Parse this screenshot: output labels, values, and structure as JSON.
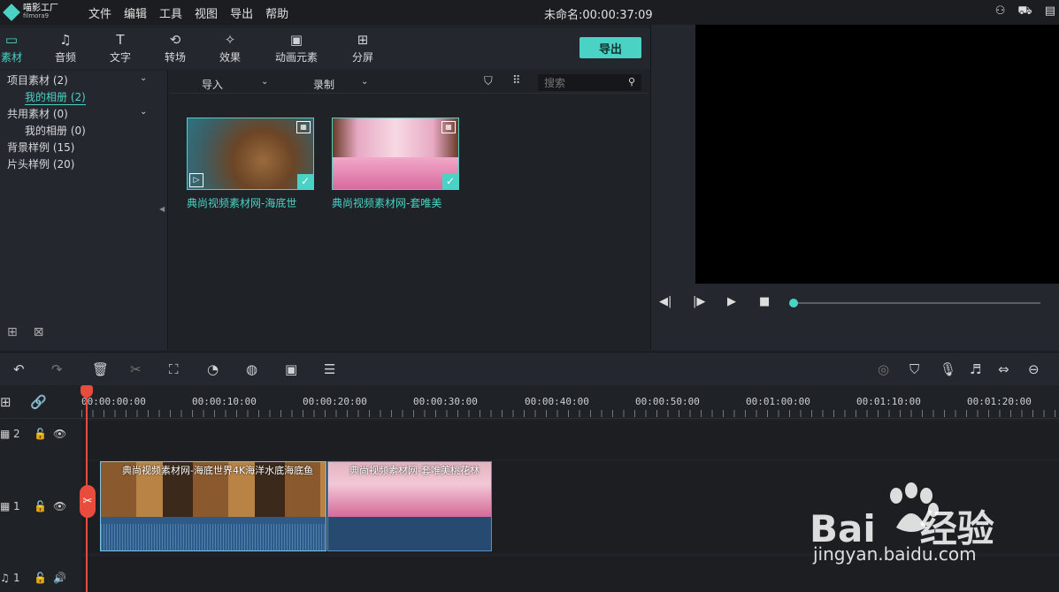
{
  "app": {
    "logo_cn": "喵影工厂",
    "logo_en": "filmora9",
    "doc_title": "未命名:00:00:37:09"
  },
  "menu": [
    "文件",
    "编辑",
    "工具",
    "视图",
    "导出",
    "帮助"
  ],
  "tabs": [
    {
      "label": "素材",
      "icon": "folder-icon",
      "glyph": "▭"
    },
    {
      "label": "音频",
      "icon": "music-note-icon",
      "glyph": "♫"
    },
    {
      "label": "文字",
      "icon": "text-icon",
      "glyph": "T"
    },
    {
      "label": "转场",
      "icon": "transition-icon",
      "glyph": "⟲"
    },
    {
      "label": "效果",
      "icon": "effects-icon",
      "glyph": "✧"
    },
    {
      "label": "动画元素",
      "icon": "image-icon",
      "glyph": "▣"
    },
    {
      "label": "分屏",
      "icon": "splitscreen-icon",
      "glyph": "⊞"
    }
  ],
  "export_label": "导出",
  "tree": [
    {
      "label": "项目素材 (2)",
      "level": 0,
      "chevron": true,
      "selected": false
    },
    {
      "label": "我的相册 (2)",
      "level": 1,
      "chevron": false,
      "selected": true
    },
    {
      "label": "共用素材 (0)",
      "level": 0,
      "chevron": true,
      "selected": false
    },
    {
      "label": "我的相册 (0)",
      "level": 1,
      "chevron": false,
      "selected": false
    },
    {
      "label": "背景样例 (15)",
      "level": 0,
      "chevron": false,
      "selected": false
    },
    {
      "label": "片头样例 (20)",
      "level": 0,
      "chevron": false,
      "selected": false
    }
  ],
  "media_toolbar": {
    "import_label": "导入",
    "record_label": "录制",
    "search_placeholder": "搜索"
  },
  "media_items": [
    {
      "label": "典尚视频素材网-海底世"
    },
    {
      "label": "典尚视频素材网-套唯美"
    }
  ],
  "ruler": [
    "00:00:00:00",
    "00:00:10:00",
    "00:00:20:00",
    "00:00:30:00",
    "00:00:40:00",
    "00:00:50:00",
    "00:01:00:00",
    "00:01:10:00",
    "00:01:20:00"
  ],
  "tracks": {
    "video2": "2",
    "video1": "1",
    "audio1": "1"
  },
  "clips": [
    {
      "title": "典尚视频素材网-海底世界4K海洋水底海底鱼"
    },
    {
      "title": "典尚视频素材网-套唯美桃花林"
    }
  ],
  "watermark": {
    "brand": "Bai",
    "brand2": "经验",
    "url": "jingyan.baidu.com"
  },
  "colors": {
    "accent": "#4ad3c4",
    "playhead": "#e74c3c",
    "clip_blue": "#2d5a86"
  }
}
